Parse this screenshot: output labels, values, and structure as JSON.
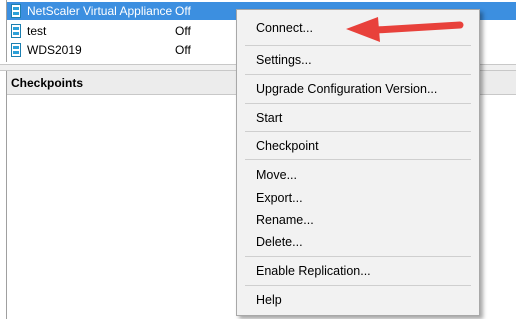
{
  "vm_list": [
    {
      "name": "NetScaler Virtual Appliance",
      "state": "Off",
      "selected": true
    },
    {
      "name": "test",
      "state": "Off",
      "selected": false
    },
    {
      "name": "WDS2019",
      "state": "Off",
      "selected": false
    }
  ],
  "checkpoints": {
    "title": "Checkpoints"
  },
  "context_menu": {
    "items": [
      "Connect...",
      "Settings...",
      "Upgrade Configuration Version...",
      "Start",
      "Checkpoint",
      "Move...",
      "Export...",
      "Rename...",
      "Delete...",
      "Enable Replication...",
      "Help"
    ]
  },
  "colors": {
    "selection": "#3c8fe0",
    "menu_background": "#f2f2f2",
    "annotation_arrow": "#e8413b",
    "vm_icon": "#2ca0d8"
  },
  "icons": {
    "vm": "virtual-machine-icon",
    "annotation": "red-arrow-annotation"
  }
}
